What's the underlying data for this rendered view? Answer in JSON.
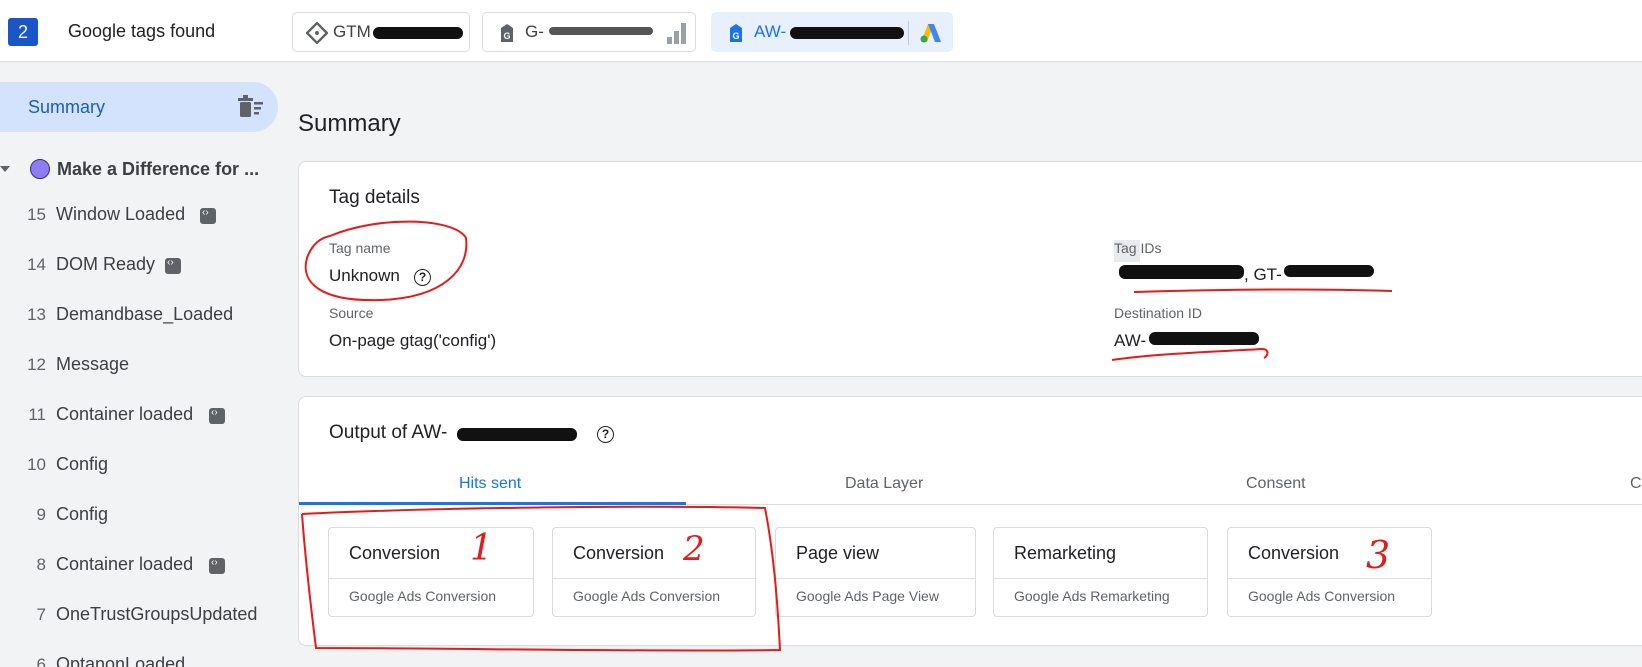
{
  "header": {
    "count": "2",
    "title": "Google tags found",
    "chips": [
      {
        "label": "GTM",
        "icon": "gtm-diamond-icon"
      },
      {
        "label": "G-",
        "icon": "tag-icon"
      },
      {
        "label": "AW-",
        "icon": "tag-icon"
      }
    ]
  },
  "sidebar": {
    "summary_label": "Summary",
    "page_label": "Make a Difference for ...",
    "events": [
      {
        "num": "15",
        "name": "Window Loaded",
        "badge": true
      },
      {
        "num": "14",
        "name": "DOM Ready",
        "badge": true
      },
      {
        "num": "13",
        "name": "Demandbase_Loaded",
        "badge": false
      },
      {
        "num": "12",
        "name": "Message",
        "badge": false
      },
      {
        "num": "11",
        "name": "Container loaded",
        "badge": true
      },
      {
        "num": "10",
        "name": "Config",
        "badge": false
      },
      {
        "num": "9",
        "name": "Config",
        "badge": false
      },
      {
        "num": "8",
        "name": "Container loaded",
        "badge": true
      },
      {
        "num": "7",
        "name": "OneTrustGroupsUpdated",
        "badge": false
      },
      {
        "num": "6",
        "name": "OptanonLoaded",
        "badge": false
      }
    ]
  },
  "main": {
    "title": "Summary",
    "tag_details": {
      "title": "Tag details",
      "tag_name_label": "Tag name",
      "tag_name_value": "Unknown",
      "source_label": "Source",
      "source_value": "On-page gtag('config')",
      "tag_ids_label": "Tag IDs",
      "tag_ids_value": ", GT-",
      "destination_label": "Destination ID",
      "destination_value": "AW-"
    },
    "output": {
      "title": "Output of AW-",
      "tabs": [
        "Hits sent",
        "Data Layer",
        "Consent",
        "C"
      ],
      "hits": [
        {
          "title": "Conversion",
          "subtitle": "Google Ads Conversion"
        },
        {
          "title": "Conversion",
          "subtitle": "Google Ads Conversion"
        },
        {
          "title": "Page view",
          "subtitle": "Google Ads Page View"
        },
        {
          "title": "Remarketing",
          "subtitle": "Google Ads Remarketing"
        },
        {
          "title": "Conversion",
          "subtitle": "Google Ads Conversion"
        }
      ]
    }
  },
  "annotations": {
    "marks": [
      "1",
      "2",
      "3"
    ],
    "color": "#e31b1b"
  },
  "colors": {
    "accent": "#1a73e8",
    "active_nav": "#d3e3fd",
    "badge_blue": "#1a56c6"
  }
}
